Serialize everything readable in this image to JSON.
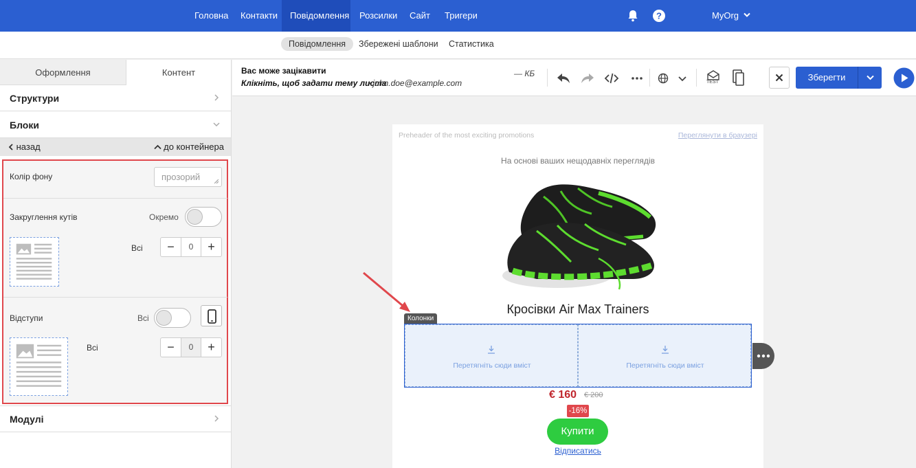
{
  "topnav": {
    "items": [
      {
        "label": "Головна"
      },
      {
        "label": "Контакти"
      },
      {
        "label": "Повідомлення",
        "active": true
      },
      {
        "label": "Розсилки"
      },
      {
        "label": "Сайт"
      },
      {
        "label": "Тригери"
      }
    ],
    "org": "MyOrg",
    "bell_icon": "bell-icon",
    "help_icon": "help-icon"
  },
  "subnav": {
    "tabs": [
      {
        "label": "Повідомлення",
        "active": true
      },
      {
        "label": "Збережені шаблони"
      },
      {
        "label": "Статистика"
      }
    ]
  },
  "left_panel": {
    "tabs": [
      {
        "label": "Оформлення"
      },
      {
        "label": "Контент"
      }
    ],
    "sections": {
      "structures": "Структури",
      "blocks": "Блоки",
      "modules": "Модулі"
    },
    "back": "назад",
    "to_container": "до контейнера",
    "props": {
      "bg_color_label": "Колір фону",
      "bg_color_value": "прозорий",
      "radius_label": "Закруглення кутів",
      "radius_separate": "Окремо",
      "radius_all": "Всі",
      "radius_value": "0",
      "padding_label": "Відступи",
      "padding_all_toggle": "Всі",
      "padding_all": "Всі",
      "padding_value": "0"
    }
  },
  "editor": {
    "subject_title": "Вас може зацікавити",
    "subject_hint": "Клікніть, щоб задати тему листа",
    "sender": "john.doe@example.com",
    "size": "— КБ",
    "save_label": "Зберегти",
    "test_label": "TEST"
  },
  "email": {
    "preheader": "Preheader of the most exciting promotions",
    "view_in_browser": "Переглянути в браузері",
    "based_on": "На основі ваших нещодавніх переглядів",
    "product_title": "Кросівки Air Max Trainers",
    "columns_label": "Колонки",
    "drop_here_1": "Перетягніть сюди вміст",
    "drop_here_2": "Перетягніть сюди вміст",
    "price": "€ 160",
    "old_price": "€ 200",
    "discount": "-16%",
    "buy": "Купити",
    "unsubscribe": "Відписатись"
  },
  "colors": {
    "nav_blue": "#2b5fd1",
    "highlight_red": "#e0474c",
    "buy_green": "#2ecc40",
    "price_red": "#c0262d"
  }
}
